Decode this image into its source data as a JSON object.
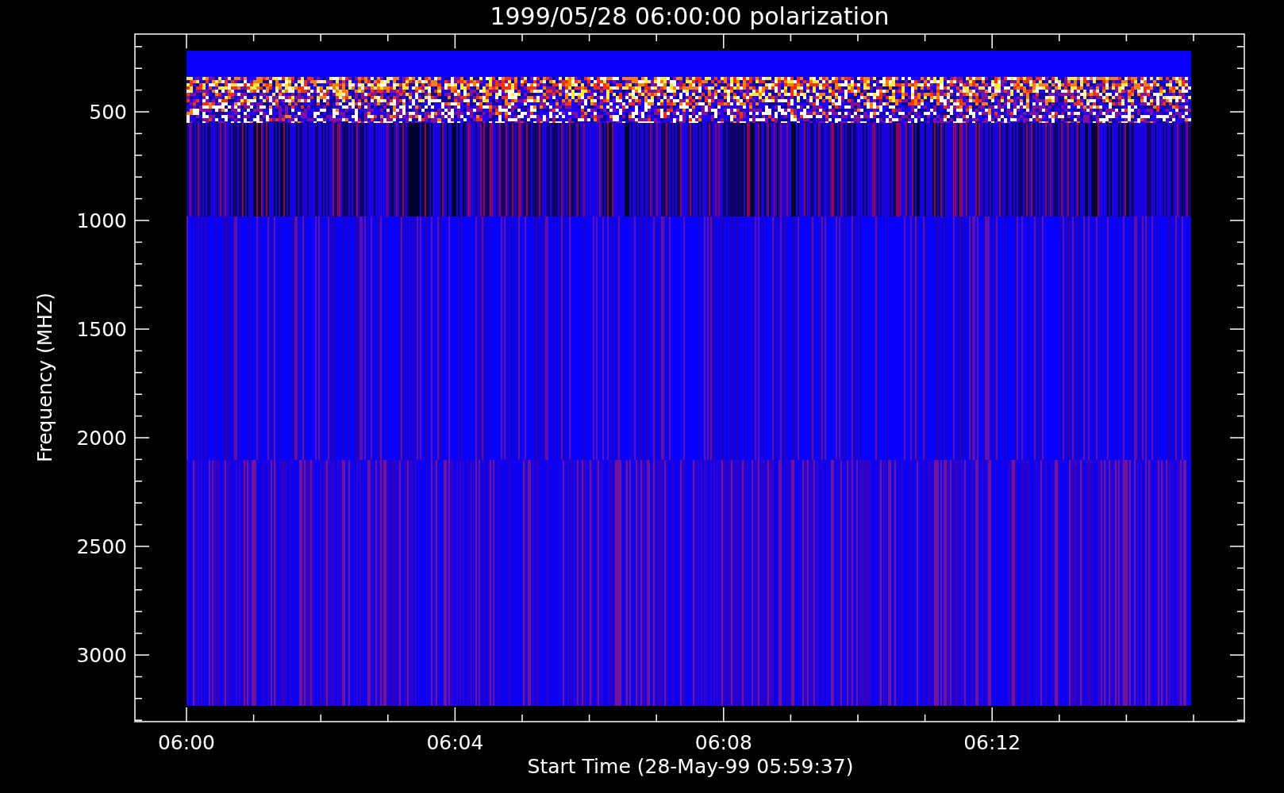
{
  "title": "1999/05/28 06:00:00 polarization",
  "y_axis": {
    "label": "Frequency (MHZ)",
    "ticks": [
      "500",
      "1000",
      "1500",
      "2000",
      "2500",
      "3000"
    ]
  },
  "x_axis": {
    "label": "Start Time (28-May-99 05:59:37)",
    "ticks": [
      "06:00",
      "06:04",
      "06:08",
      "06:12"
    ]
  }
}
